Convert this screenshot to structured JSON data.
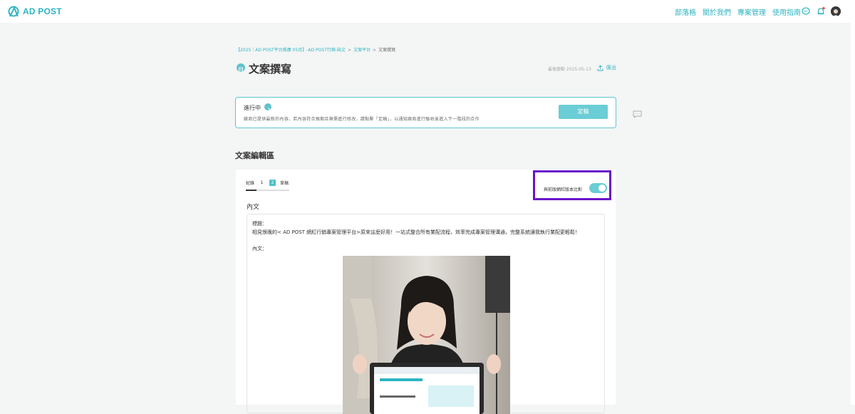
{
  "header": {
    "logo_text": "AD POST",
    "nav": [
      "部落格",
      "關於我們",
      "專案管理",
      "使用指南"
    ],
    "icons": [
      "chat-bubble-icon",
      "bell-icon",
      "avatar"
    ]
  },
  "breadcrumb": {
    "items": [
      "【2025｜AD POST平台推廣 05月】-AD POST行銷-貼文",
      "文案平台",
      "文案撰寫"
    ],
    "separator": ">"
  },
  "page": {
    "title": "文案撰寫",
    "modified": "最後變動 2025-05-13",
    "export_label": "匯出"
  },
  "status": {
    "label": "進行中",
    "description": "廠商已提供最新的內容，若內容符合預期且無需進行修改，請點擊「定稿」，以通知廠商進行驗收並進入下一階段的合作",
    "finalize_button": "定稿"
  },
  "editor": {
    "section_title": "文案編輯區",
    "tabs": {
      "record_label": "紀錄",
      "versions": [
        "1",
        "2"
      ],
      "active_version": "2",
      "draft_label": "草稿"
    },
    "compare_label": "與前版網紅版本比對",
    "compare_enabled": true,
    "body_label": "內文",
    "content": {
      "title_label": "標題：",
      "title_text": "相見恨晚的< AD POST 網紅行銷專案管理平台>原來這麼好用！一站式整合所有業配流程，效率完成專案管理溝通，完整系統讓我執行業配更輕鬆！",
      "body_label": "內文："
    }
  },
  "colors": {
    "accent": "#2eb4c2",
    "highlight": "#6a12c9",
    "button": "#6bcdd5"
  }
}
